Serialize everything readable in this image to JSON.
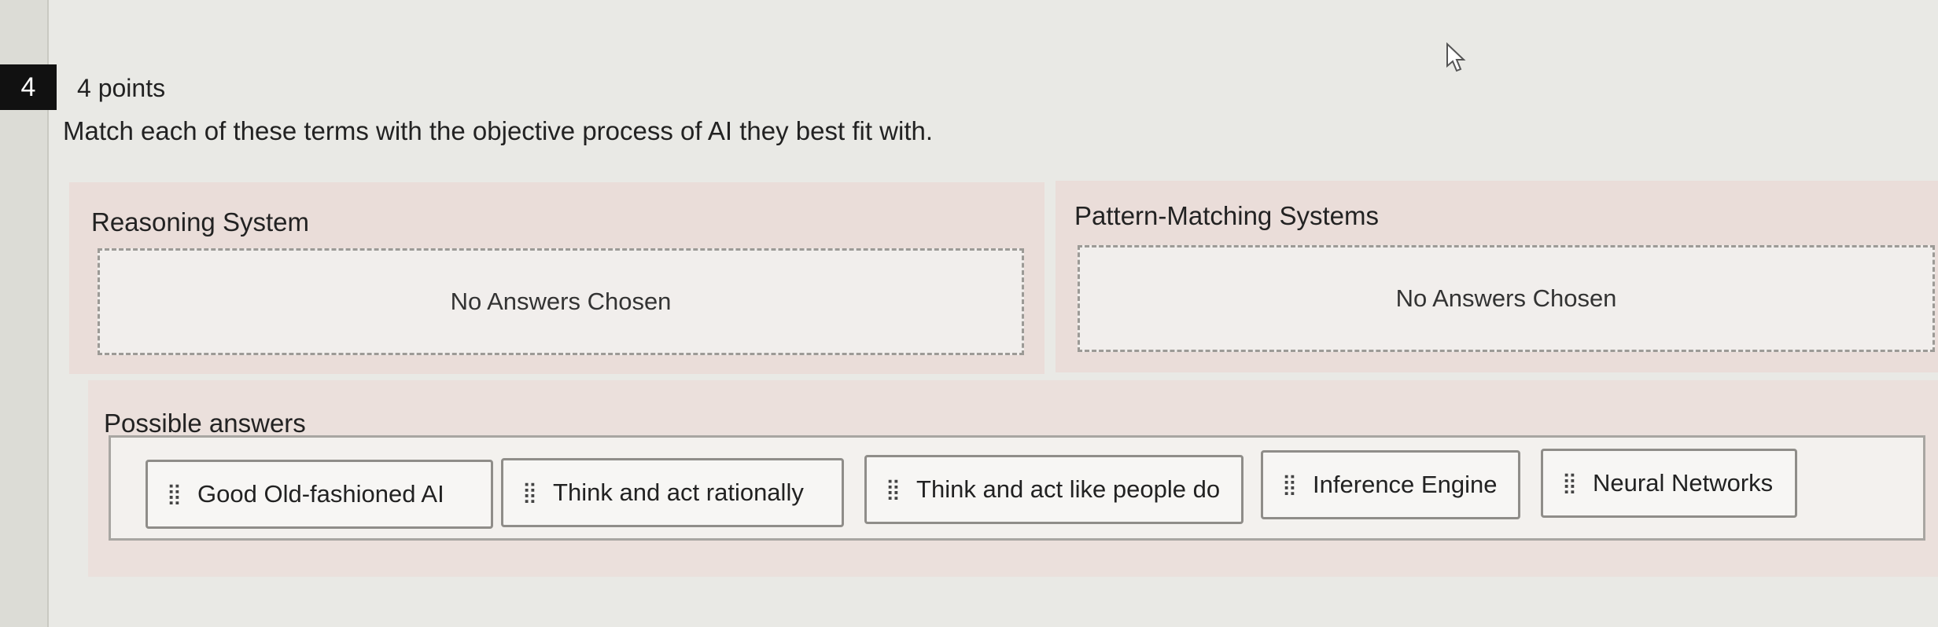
{
  "question": {
    "number": "4",
    "points": "4 points",
    "prompt": "Match each of these terms with the objective process of AI they best fit with."
  },
  "categories": [
    {
      "title": "Reasoning System",
      "placeholder": "No Answers Chosen"
    },
    {
      "title": "Pattern-Matching Systems",
      "placeholder": "No Answers Chosen"
    }
  ],
  "possible_answers": {
    "title": "Possible answers",
    "items": [
      {
        "label": "Good Old-fashioned AI",
        "icon": "drag-handle-icon"
      },
      {
        "label": "Think and act rationally",
        "icon": "drag-handle-icon"
      },
      {
        "label": "Think and act like people do",
        "icon": "drag-handle-icon"
      },
      {
        "label": "Inference Engine",
        "icon": "drag-handle-icon"
      },
      {
        "label": "Neural Networks",
        "icon": "drag-handle-icon"
      }
    ]
  },
  "colors": {
    "question_badge": "#111111",
    "category_bg": "#eaddd9",
    "page_bg": "#e9e9e5"
  }
}
